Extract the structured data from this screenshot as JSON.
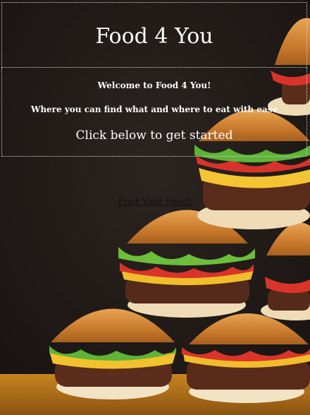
{
  "header": {
    "title": "Food 4 You"
  },
  "intro": {
    "welcome": "Welcome to Food 4 You!",
    "tagline": "Where you can find what and where to eat with ease",
    "cta": "Click below to get started"
  },
  "nav": {
    "find_link": "Find Your Food!"
  },
  "background": {
    "image": "burger-stack-photo"
  }
}
